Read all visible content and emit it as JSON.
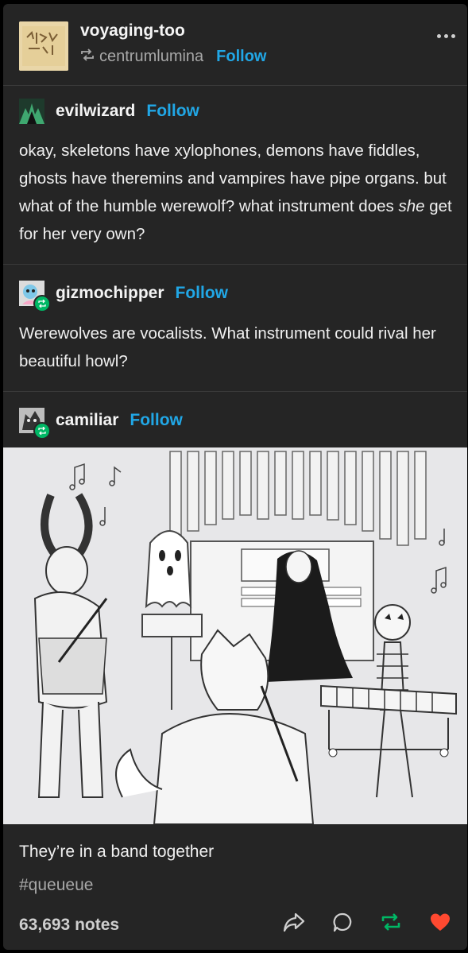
{
  "post": {
    "blog_name": "voyaging-too",
    "reblogged_from": "centrumlumina",
    "follow_label": "Follow"
  },
  "trail": [
    {
      "name": "evilwizard",
      "follow_label": "Follow",
      "text_before": "okay, skeletons have xylophones, demons have fiddles, ghosts have theremins and vampires have pipe organs. but what of the humble werewolf? what instrument does ",
      "text_em": "she",
      "text_after": " get for her very own?"
    },
    {
      "name": "gizmochipper",
      "follow_label": "Follow",
      "text": "Werewolves are vocalists. What instrument could rival her beautiful howl?"
    },
    {
      "name": "camiliar",
      "follow_label": "Follow"
    }
  ],
  "caption": "They’re in a band together",
  "tag": "#queueue",
  "notes": "63,693 notes",
  "colors": {
    "accent": "#21a7e6",
    "reblog": "#00b765",
    "like": "#ff4930",
    "background": "#252525"
  },
  "icons": {
    "more": "more-icon",
    "share": "share-icon",
    "reply": "reply-icon",
    "reblog": "reblog-icon",
    "like": "heart-icon"
  }
}
